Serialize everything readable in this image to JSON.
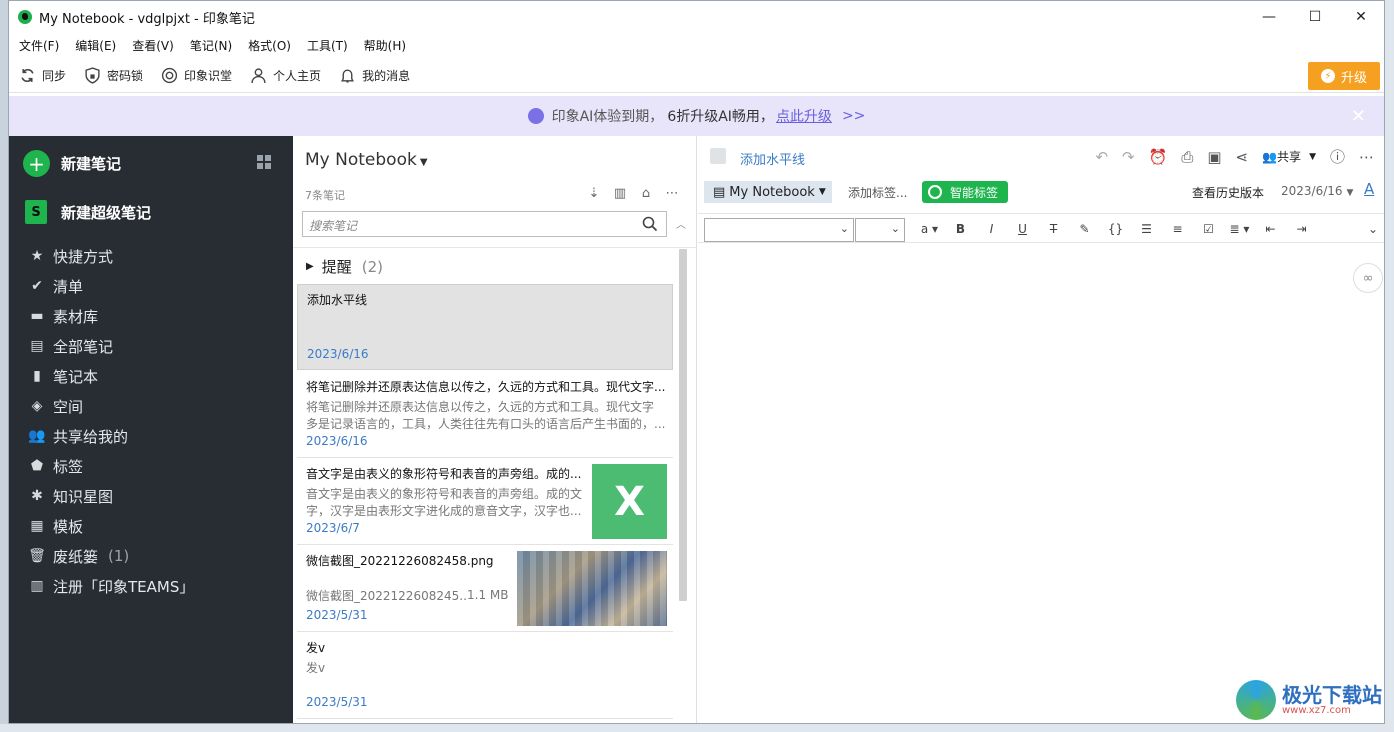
{
  "window": {
    "title": "My Notebook - vdglpjxt - 印象笔记",
    "controls": {
      "minimize": "—",
      "maximize": "☐",
      "close": "✕"
    }
  },
  "menu": [
    "文件(F)",
    "编辑(E)",
    "查看(V)",
    "笔记(N)",
    "格式(O)",
    "工具(T)",
    "帮助(H)"
  ],
  "toolbar": {
    "items": [
      {
        "label": "同步",
        "icon": "sync-icon"
      },
      {
        "label": "密码锁",
        "icon": "lock-icon"
      },
      {
        "label": "印象识堂",
        "icon": "class-icon"
      },
      {
        "label": "个人主页",
        "icon": "user-icon"
      },
      {
        "label": "我的消息",
        "icon": "bell-icon"
      }
    ],
    "upgrade_label": "升级"
  },
  "banner": {
    "text": "印象AI体验到期，",
    "bold": "6折升级AI畅用，",
    "link": "点此升级",
    "arrows": ">>",
    "close": "✕"
  },
  "sidebar": {
    "new_note": "新建笔记",
    "new_super_note": "新建超级笔记",
    "super_icon_text": "S",
    "items": [
      {
        "label": "快捷方式",
        "icon": "★"
      },
      {
        "label": "清单",
        "icon": "✔"
      },
      {
        "label": "素材库",
        "icon": "▬"
      },
      {
        "label": "全部笔记",
        "icon": "▤"
      },
      {
        "label": "笔记本",
        "icon": "▮"
      },
      {
        "label": "空间",
        "icon": "◈"
      },
      {
        "label": "共享给我的",
        "icon": "👥"
      },
      {
        "label": "标签",
        "icon": "⬟"
      },
      {
        "label": "知识星图",
        "icon": "✱"
      },
      {
        "label": "模板",
        "icon": "▦"
      },
      {
        "label": "废纸篓",
        "icon": "🗑",
        "count": "(1)"
      },
      {
        "label": "注册「印象TEAMS」",
        "icon": "▥"
      }
    ]
  },
  "notelist": {
    "title": "My Notebook",
    "count": "7条笔记",
    "search_placeholder": "搜索笔记",
    "reminder_label": "提醒",
    "reminder_count": "(2)",
    "notes": [
      {
        "title": "添加水平线",
        "snippet": "",
        "date": "2023/6/16"
      },
      {
        "title": "将笔记删除并还原表达信息以传之，久远的方式和工具。现代文字...",
        "snippet_line1": "将笔记删除并还原表达信息以传之，久远的方式和工具。现代文字",
        "snippet_line2": "多是记录语言的，工具，人类往往先有口头的语言后产生书面的，...",
        "date": "2023/6/16"
      },
      {
        "title": "音文字是由表义的象形符号和表音的声旁组。成的...",
        "snippet_line1": "音文字是由表义的象形符号和表音的声旁组。成的文",
        "snippet_line2": "字，汉字是由表形文字进化成的意音文字，汉字也...",
        "date": "2023/6/7"
      },
      {
        "title": "微信截图_20221226082458.png",
        "snippet_line1": "微信截图_2022122608245...",
        "file_size": "1.1 MB",
        "date": "2023/5/31"
      },
      {
        "title": "发v",
        "snippet_line1": "发v",
        "date": "2023/5/31"
      }
    ]
  },
  "editor": {
    "title": "添加水平线",
    "share_label": "共享",
    "notebook_chip": "My Notebook",
    "add_tag": "添加标签...",
    "smart_tag": "智能标签",
    "history": "查看历史版本",
    "date": "2023/6/16",
    "font_button": "A"
  },
  "watermark": {
    "text": "极光下载站",
    "url": "www.xz7.com"
  }
}
